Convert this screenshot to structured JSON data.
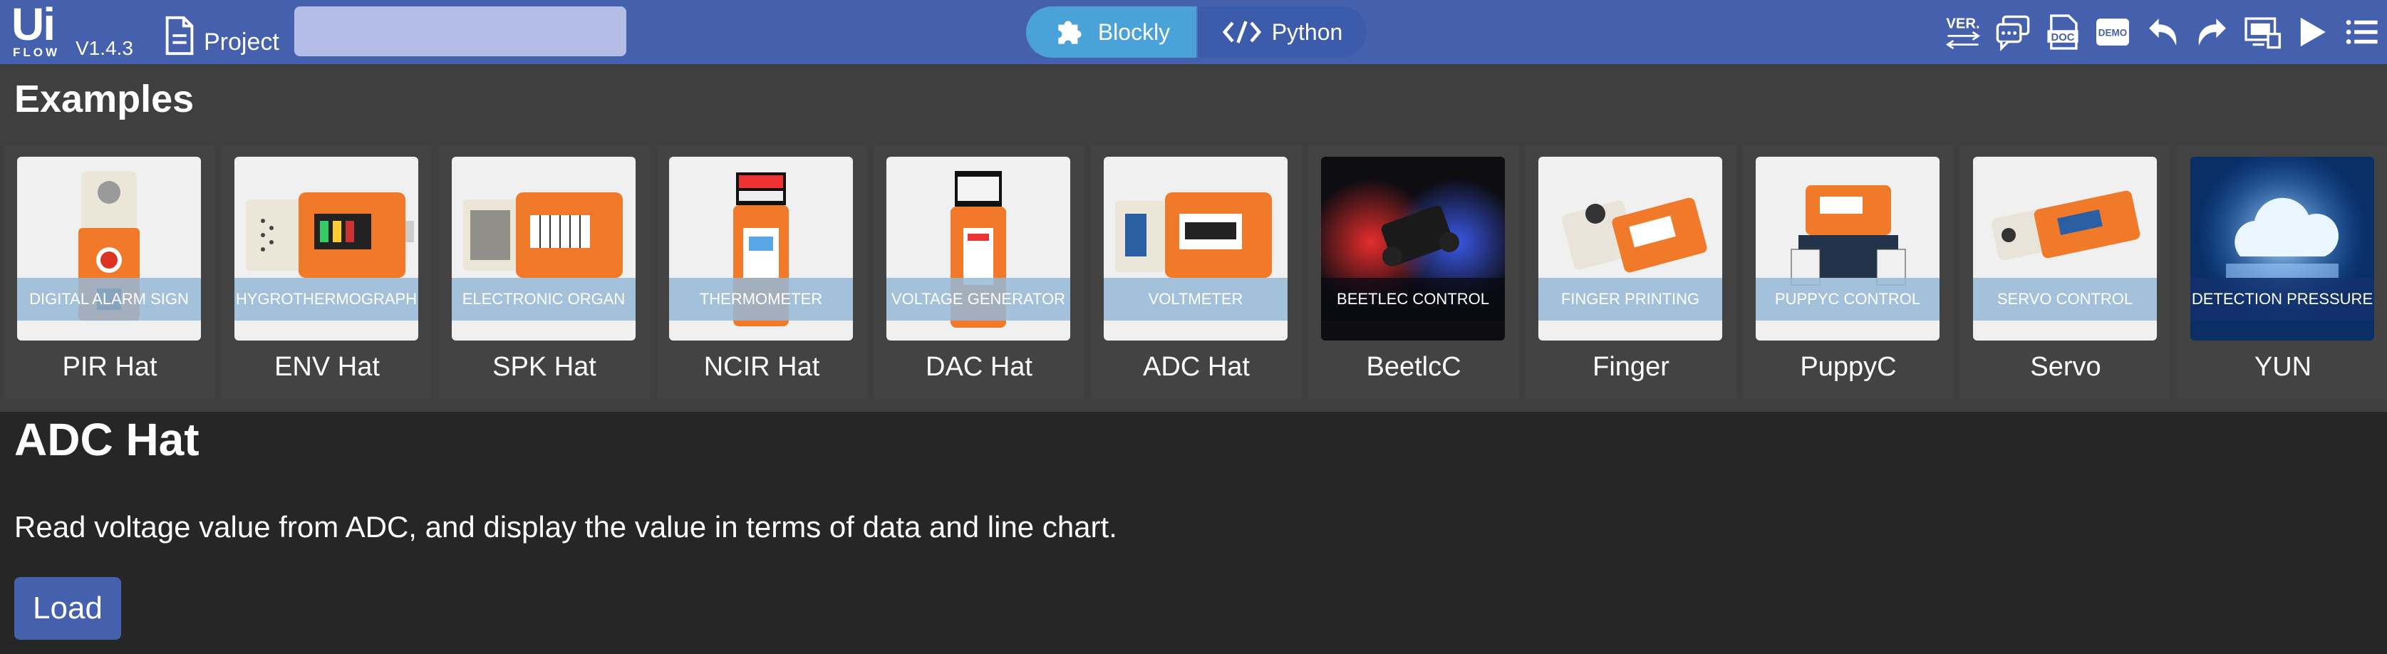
{
  "header": {
    "logo_text": "Ui",
    "logo_sub": "FLOW",
    "version": "V1.4.3",
    "project_label": "Project",
    "project_input_value": "",
    "modes": [
      {
        "label": "Blockly",
        "active": true
      },
      {
        "label": "Python",
        "active": false
      }
    ],
    "tools": [
      {
        "icon": "version-icon",
        "text": "VER."
      },
      {
        "icon": "chat-icon",
        "text": ""
      },
      {
        "icon": "doc-icon",
        "text": "DOC"
      },
      {
        "icon": "demo-icon",
        "text": "DEMO"
      },
      {
        "icon": "undo-icon",
        "text": ""
      },
      {
        "icon": "redo-icon",
        "text": ""
      },
      {
        "icon": "device-icon",
        "text": ""
      },
      {
        "icon": "run-icon",
        "text": ""
      },
      {
        "icon": "menu-icon",
        "text": ""
      }
    ],
    "colors": {
      "bar": "#4560ad",
      "blockly": "#4aa2d8",
      "python": "#3d5bab"
    }
  },
  "examples": {
    "title": "Examples",
    "items": [
      {
        "name": "PIR Hat",
        "caption": "DIGITAL ALARM SIGN",
        "theme": "light"
      },
      {
        "name": "ENV Hat",
        "caption": "HYGROTHERMOGRAPH",
        "theme": "light"
      },
      {
        "name": "SPK Hat",
        "caption": "ELECTRONIC ORGAN",
        "theme": "light"
      },
      {
        "name": "NCIR Hat",
        "caption": "THERMOMETER",
        "theme": "light"
      },
      {
        "name": "DAC Hat",
        "caption": "VOLTAGE GENERATOR",
        "theme": "light"
      },
      {
        "name": "ADC Hat",
        "caption": "VOLTMETER",
        "theme": "light"
      },
      {
        "name": "BeetlcC",
        "caption": "BEETLEC CONTROL",
        "theme": "dark"
      },
      {
        "name": "Finger",
        "caption": "FINGER PRINTING",
        "theme": "light"
      },
      {
        "name": "PuppyC",
        "caption": "PUPPYC CONTROL",
        "theme": "light"
      },
      {
        "name": "Servo",
        "caption": "SERVO CONTROL",
        "theme": "light"
      },
      {
        "name": "YUN",
        "caption": "DETECTION PRESSURE",
        "theme": "blue"
      }
    ]
  },
  "detail": {
    "title": "ADC Hat",
    "description": "Read voltage value from ADC, and display the value in terms of data and line chart.",
    "load_label": "Load"
  }
}
